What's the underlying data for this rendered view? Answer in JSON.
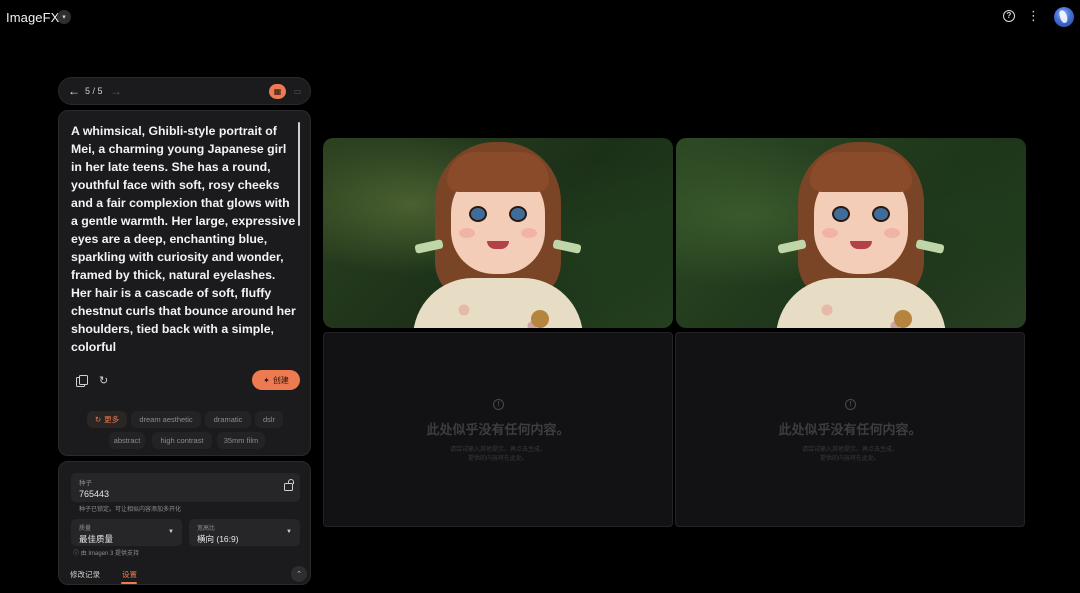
{
  "header": {
    "app_title": "ImageFX",
    "app_menu_icon": "chevron-down-icon",
    "help_icon": "help-circle-icon",
    "more_icon": "more-vert-icon",
    "avatar_icon": "user-avatar"
  },
  "navigator": {
    "back_symbol": "←",
    "position": "5 / 5",
    "forward_symbol": "→",
    "view_grid_icon": "grid-view-icon",
    "view_single_icon": "single-view-icon"
  },
  "prompt": {
    "text": "A whimsical, Ghibli-style portrait of Mei, a charming young Japanese girl in her late teens. She has a round, youthful face with soft, rosy cheeks and a fair complexion that glows with a gentle warmth. Her large, expressive eyes are a deep, enchanting blue, sparkling with curiosity and wonder, framed by thick, natural eyelashes. Her hair is a cascade of soft, fluffy chestnut curls that bounce around her shoulders, tied back with a simple, colorful",
    "copy_icon": "copy-icon",
    "reset_icon": "reset-icon",
    "create_symbol": "✦",
    "create_label": "创建"
  },
  "chips": {
    "more_symbol": "↻",
    "more_label": "更多",
    "items": [
      "dream aesthetic",
      "dramatic",
      "dslr",
      "abstract",
      "high contrast",
      "35mm film"
    ]
  },
  "settings": {
    "seed_label": "种子",
    "seed_value": "765443",
    "lock_icon": "lock-icon",
    "seed_hint": "种子已锁定。可让相似内容添加多开化",
    "quality_label": "质量",
    "quality_value": "最佳质量",
    "aspect_label": "宽高比",
    "aspect_value": "横向 (16:9)",
    "model_note": "由 Imagen 3 提供支持",
    "tab_history": "修改记录",
    "tab_settings": "设置",
    "collapse_icon": "collapse-icon"
  },
  "images": [
    {
      "alt_icon": "generated-image-1"
    },
    {
      "alt_icon": "generated-image-2"
    }
  ],
  "empty_slots": {
    "icon": "info-icon",
    "title": "此处似乎没有任何内容。",
    "line1": "请尝试输入其他提示。再点击生成，",
    "line2": "提供的内容将在此处。"
  },
  "colors": {
    "accent": "#ee7a52",
    "background": "#000000",
    "panel": "#1b1b1d"
  }
}
